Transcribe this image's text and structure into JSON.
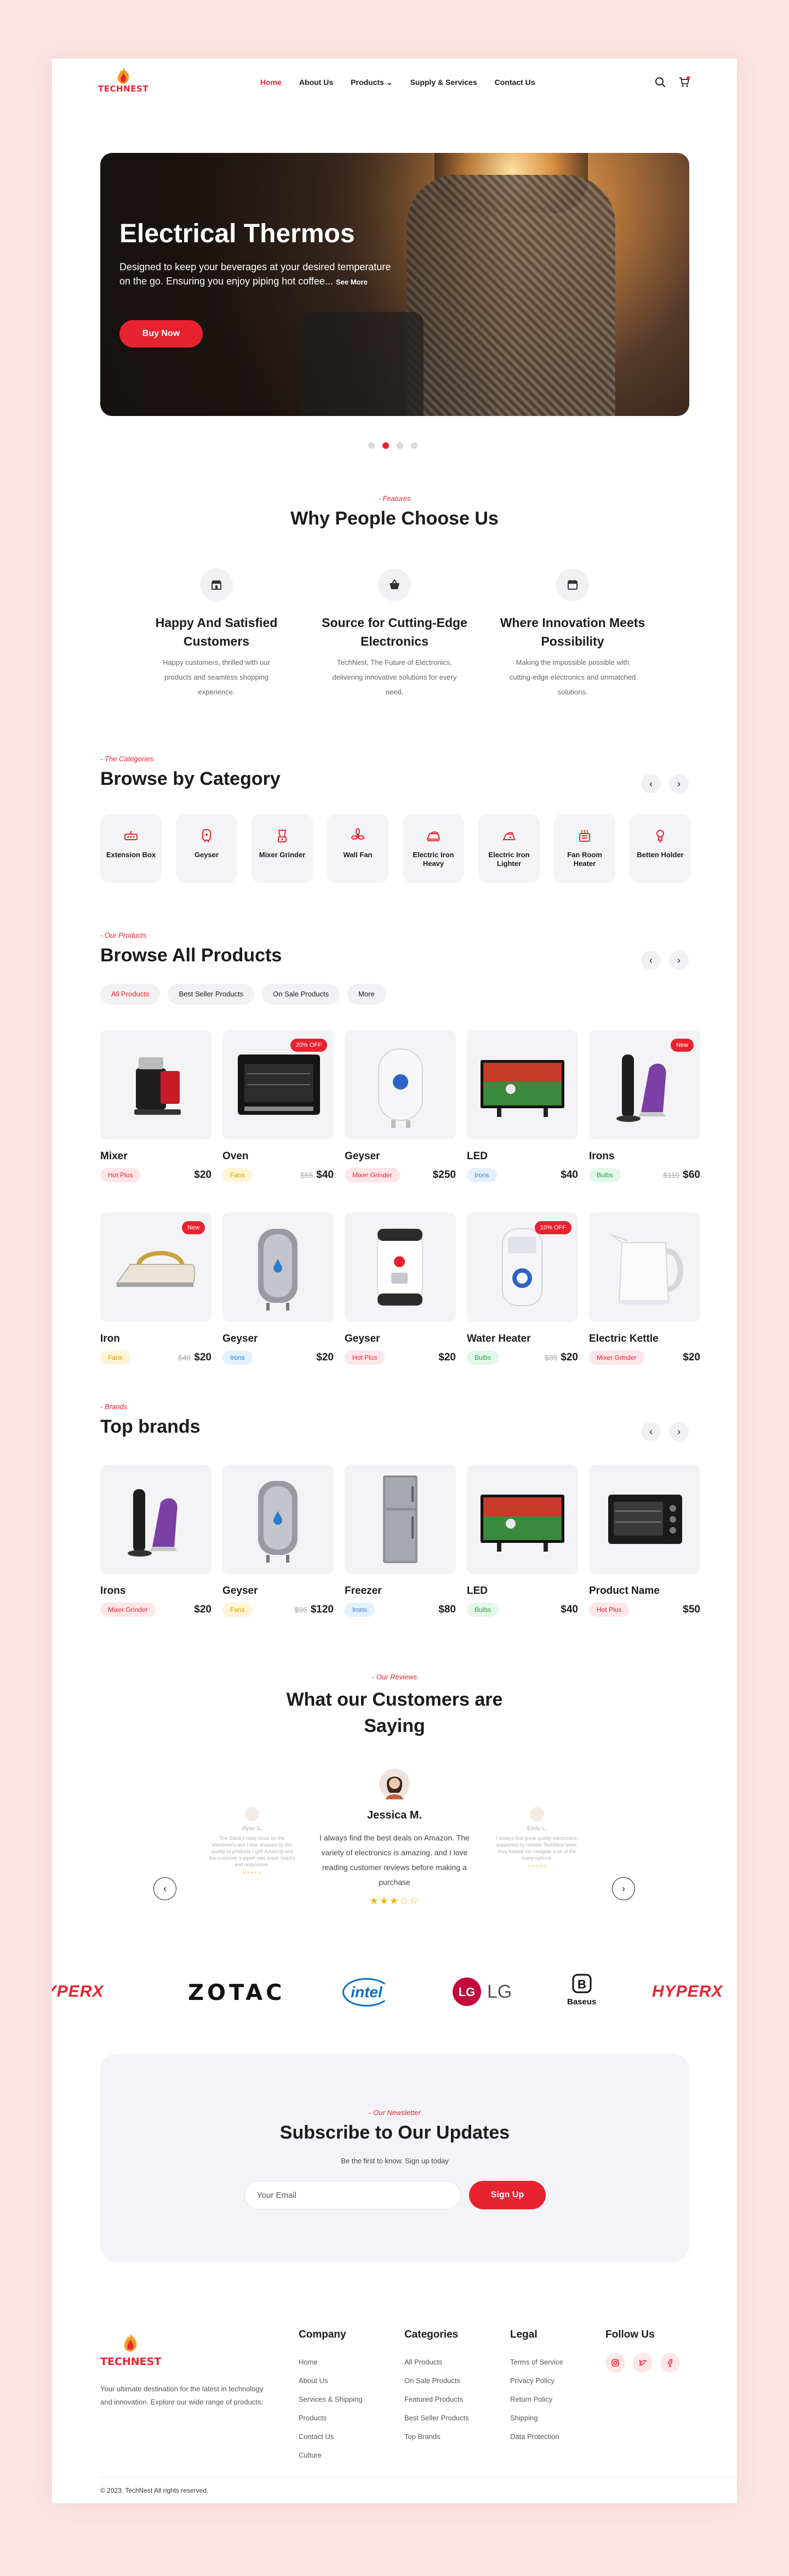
{
  "brand": {
    "name": "TECHNEST"
  },
  "nav": {
    "links": [
      {
        "label": "Home"
      },
      {
        "label": "About Us"
      },
      {
        "label": "Products"
      },
      {
        "label": "Supply & Services"
      },
      {
        "label": "Contact Us"
      }
    ]
  },
  "hero": {
    "title": "Electrical Thermos",
    "text": "Designed to keep your beverages at your desired temperature on the go. Ensuring you enjoy piping hot coffee...",
    "see_more": "See More",
    "button": "Buy Now",
    "slides": 4,
    "active_slide": 2
  },
  "features": {
    "eyebrow": "- Features",
    "title": "Why People Choose Us",
    "items": [
      {
        "icon": "store-icon",
        "title": "Happy And Satisfied Customers",
        "text": "Happy customers, thrilled with our products and seamless shopping experience."
      },
      {
        "icon": "basket-icon",
        "title": "Source for Cutting-Edge Electronics",
        "text": "TechNest, The Future of Electronics, delivering innovative solutions for every need."
      },
      {
        "icon": "calendar-icon",
        "title": "Where Innovation Meets Possibility",
        "text": "Making the impossible possible with cutting-edge electronics and unmatched solutions."
      }
    ]
  },
  "categories": {
    "eyebrow": "- The Categories",
    "title": "Browse by Category",
    "items": [
      {
        "label": "Extension Box"
      },
      {
        "label": "Geyser"
      },
      {
        "label": "Mixer Grinder"
      },
      {
        "label": "Wall Fan"
      },
      {
        "label": "Electric Iron Heavy"
      },
      {
        "label": "Electric Iron Lighter"
      },
      {
        "label": "Fan Room Heater"
      },
      {
        "label": "Betten Holder"
      }
    ]
  },
  "products": {
    "eyebrow": "- Our Products",
    "title": "Browse All Products",
    "tabs": [
      {
        "label": "All Products"
      },
      {
        "label": "Best Seller Products"
      },
      {
        "label": "On Sale Products"
      },
      {
        "label": "More"
      }
    ],
    "row1": [
      {
        "name": "Mixer",
        "tag": "Hot Plus",
        "tag_color": "red",
        "old": "",
        "price": "$20",
        "badge": ""
      },
      {
        "name": "Oven",
        "tag": "Fans",
        "tag_color": "yel",
        "old": "$55",
        "price": "$40",
        "badge": "20% OFF"
      },
      {
        "name": "Geyser",
        "tag": "Mixer Grinder",
        "tag_color": "red",
        "old": "",
        "price": "$250",
        "badge": ""
      },
      {
        "name": "LED",
        "tag": "Irons",
        "tag_color": "blue",
        "old": "",
        "price": "$40",
        "badge": ""
      },
      {
        "name": "Irons",
        "tag": "Bulbs",
        "tag_color": "grn",
        "old": "$110",
        "price": "$60",
        "badge": "New"
      }
    ],
    "row2": [
      {
        "name": "Iron",
        "tag": "Fans",
        "tag_color": "yel",
        "old": "$40",
        "price": "$20",
        "badge": "New"
      },
      {
        "name": "Geyser",
        "tag": "Irons",
        "tag_color": "blue",
        "old": "",
        "price": "$20",
        "badge": ""
      },
      {
        "name": "Geyser",
        "tag": "Hot Plus",
        "tag_color": "red",
        "old": "",
        "price": "$20",
        "badge": ""
      },
      {
        "name": "Water Heater",
        "tag": "Bulbs",
        "tag_color": "grn",
        "old": "$35",
        "price": "$20",
        "badge": "10% OFF"
      },
      {
        "name": "Electric Kettle",
        "tag": "Mixer Grinder",
        "tag_color": "red",
        "old": "",
        "price": "$20",
        "badge": ""
      }
    ]
  },
  "brands_section": {
    "eyebrow": "- Brands",
    "title": "Top brands",
    "items": [
      {
        "name": "Irons",
        "tag": "Mixer Grinder",
        "tag_color": "red",
        "old": "",
        "price": "$20",
        "badge": ""
      },
      {
        "name": "Geyser",
        "tag": "Fans",
        "tag_color": "yel",
        "old": "$95",
        "price": "$120",
        "badge": ""
      },
      {
        "name": "Freezer",
        "tag": "Irons",
        "tag_color": "blue",
        "old": "",
        "price": "$80",
        "badge": ""
      },
      {
        "name": "LED",
        "tag": "Bulbs",
        "tag_color": "grn",
        "old": "",
        "price": "$40",
        "badge": ""
      },
      {
        "name": "Product Name",
        "tag": "Hot Plus",
        "tag_color": "red",
        "old": "",
        "price": "$50",
        "badge": ""
      }
    ]
  },
  "reviews": {
    "eyebrow": "- Our Reviews",
    "title": "What our Customers are Saying",
    "left": {
      "name": "Ryan S.",
      "text": "The Black Friday deals on the electronics and I was amazed by the quality of products I got! Amazing and the customer support was super helpful and responsive.",
      "stars": "★★★★★"
    },
    "main": {
      "name": "Jessica M.",
      "text": "I always find the best deals on Amazon. The variety of electronics is amazing, and I love reading customer reviews before making a purchase",
      "stars": "★★★☆☆"
    },
    "right": {
      "name": "Emily L.",
      "text": "I always find great quality electronics, supported by reliable TechNest team, they helped me navigate a lot of the many options.",
      "stars": "★★★★★"
    }
  },
  "logos": [
    "HYPERX",
    "ZOTAC",
    "intel",
    "LG",
    "Baseus",
    "HYPERX"
  ],
  "subscribe": {
    "eyebrow": "- Our Newsletter",
    "title": "Subscribe to Our Updates",
    "lead": "Be the first to know. Sign up today",
    "placeholder": "Your Email",
    "button": "Sign Up"
  },
  "footer": {
    "description": "Your ultimate destination for the latest in technology and innovation. Explore our wide range of products.",
    "company": {
      "title": "Company",
      "links": [
        "Home",
        "About Us",
        "Services & Shipping",
        "Products",
        "Contact Us",
        "Culture"
      ]
    },
    "categories": {
      "title": "Categories",
      "links": [
        "All Products",
        "On Sale Products",
        "Featured Products",
        "Best Seller Products",
        "Top Brands"
      ]
    },
    "legal": {
      "title": "Legal",
      "links": [
        "Terms of Service",
        "Privacy Policy",
        "Return Policy",
        "Shipping",
        "Data Protection"
      ]
    },
    "follow": {
      "title": "Follow Us"
    },
    "copyright": "© 2023. TechNest All rights reserved."
  },
  "colors": {
    "accent": "#e8232f",
    "background": "#fbe4e4"
  }
}
